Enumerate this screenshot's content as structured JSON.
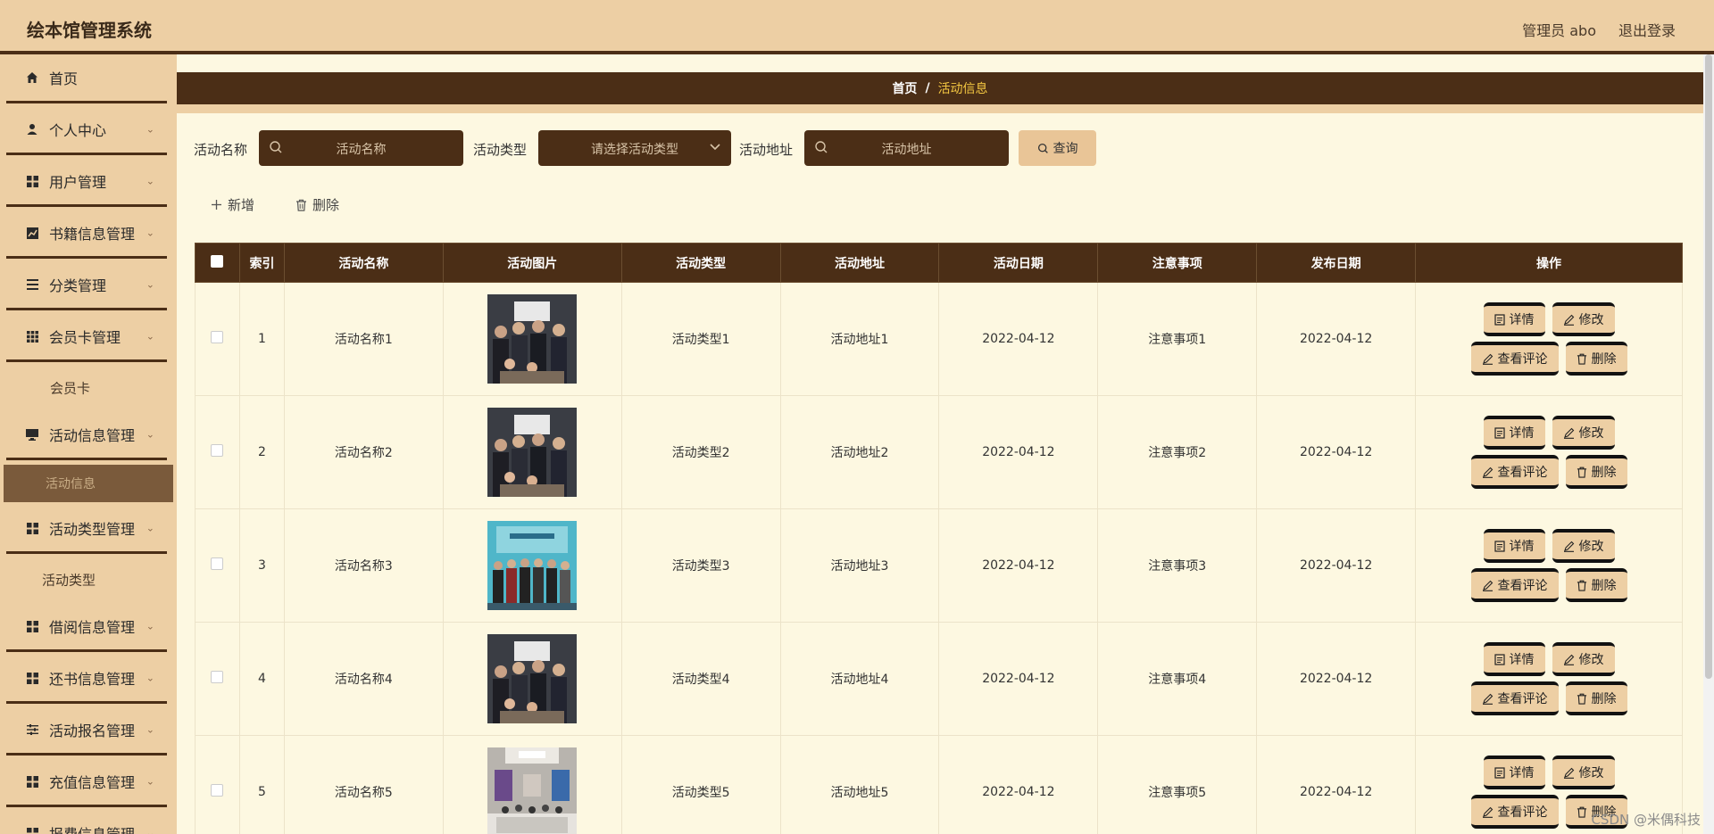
{
  "header": {
    "title": "绘本馆管理系统",
    "user": "管理员 abo",
    "logout": "退出登录"
  },
  "sidebar": {
    "items": [
      {
        "label": "首页",
        "icon": "home-icon",
        "arrow": false
      },
      {
        "label": "个人中心",
        "icon": "user-icon",
        "arrow": true
      },
      {
        "label": "用户管理",
        "icon": "grid-icon",
        "arrow": true
      },
      {
        "label": "书籍信息管理",
        "icon": "chart-icon",
        "arrow": true
      },
      {
        "label": "分类管理",
        "icon": "list-icon",
        "arrow": true
      },
      {
        "label": "会员卡管理",
        "icon": "apps-icon",
        "arrow": true
      },
      {
        "label": "活动信息管理",
        "icon": "monitor-icon",
        "arrow": true
      },
      {
        "label": "活动类型管理",
        "icon": "grid-icon",
        "arrow": true
      },
      {
        "label": "借阅信息管理",
        "icon": "grid-icon",
        "arrow": true
      },
      {
        "label": "还书信息管理",
        "icon": "grid-icon",
        "arrow": true
      },
      {
        "label": "活动报名管理",
        "icon": "sliders-icon",
        "arrow": true
      },
      {
        "label": "充值信息管理",
        "icon": "grid-icon",
        "arrow": true
      },
      {
        "label": "报费信息管理",
        "icon": "grid-icon",
        "arrow": true
      }
    ],
    "subs": {
      "membership": "会员卡",
      "activity_info": "活动信息",
      "activity_type": "活动类型"
    }
  },
  "breadcrumb": {
    "home": "首页",
    "sep": "/",
    "current": "活动信息"
  },
  "filters": {
    "name_label": "活动名称",
    "name_placeholder": "活动名称",
    "type_label": "活动类型",
    "type_placeholder": "请选择活动类型",
    "addr_label": "活动地址",
    "addr_placeholder": "活动地址",
    "search": "查询"
  },
  "actions": {
    "add": "新增",
    "delete": "删除"
  },
  "table": {
    "headers": [
      "索引",
      "活动名称",
      "活动图片",
      "活动类型",
      "活动地址",
      "活动日期",
      "注意事项",
      "发布日期",
      "操作"
    ],
    "rows": [
      {
        "index": "1",
        "name": "活动名称1",
        "type": "活动类型1",
        "addr": "活动地址1",
        "date": "2022-04-12",
        "note": "注意事项1",
        "pub": "2022-04-12"
      },
      {
        "index": "2",
        "name": "活动名称2",
        "type": "活动类型2",
        "addr": "活动地址2",
        "date": "2022-04-12",
        "note": "注意事项2",
        "pub": "2022-04-12"
      },
      {
        "index": "3",
        "name": "活动名称3",
        "type": "活动类型3",
        "addr": "活动地址3",
        "date": "2022-04-12",
        "note": "注意事项3",
        "pub": "2022-04-12"
      },
      {
        "index": "4",
        "name": "活动名称4",
        "type": "活动类型4",
        "addr": "活动地址4",
        "date": "2022-04-12",
        "note": "注意事项4",
        "pub": "2022-04-12"
      },
      {
        "index": "5",
        "name": "活动名称5",
        "type": "活动类型5",
        "addr": "活动地址5",
        "date": "2022-04-12",
        "note": "注意事项5",
        "pub": "2022-04-12"
      }
    ],
    "ops": {
      "detail": "详情",
      "edit": "修改",
      "comments": "查看评论",
      "delete": "删除"
    }
  },
  "watermark": "CSDN @米偶科技",
  "colors": {
    "header_bg": "#edcfa4",
    "dark_brown": "#4b2e16",
    "page_bg": "#fdf8e1",
    "accent_yellow": "#f5c842"
  }
}
